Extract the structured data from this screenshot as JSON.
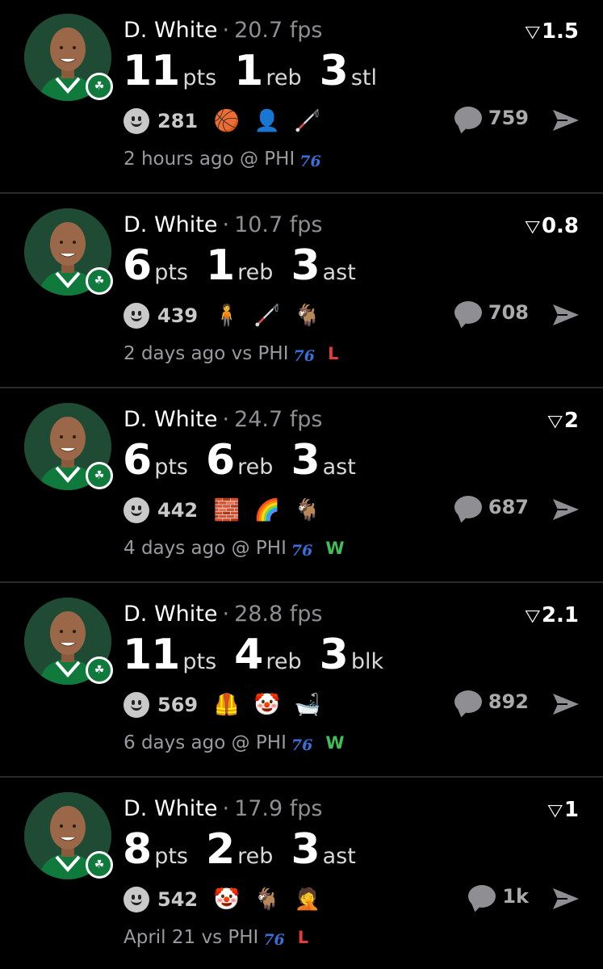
{
  "feed": {
    "posts": [
      {
        "player": "D. White",
        "fps": "20.7 fps",
        "rating": "1.5",
        "stats": [
          {
            "value": "11",
            "label": "pts"
          },
          {
            "value": "1",
            "label": "reb"
          },
          {
            "value": "3",
            "label": "stl"
          }
        ],
        "reaction_count": "281",
        "emojis": [
          "basketball-net",
          "face",
          "cane"
        ],
        "comment_count": "759",
        "time": "2 hours ago @ PHI",
        "team_logo": "76",
        "result": "",
        "result_color": ""
      },
      {
        "player": "D. White",
        "fps": "10.7 fps",
        "rating": "0.8",
        "stats": [
          {
            "value": "6",
            "label": "pts"
          },
          {
            "value": "1",
            "label": "reb"
          },
          {
            "value": "3",
            "label": "ast"
          }
        ],
        "reaction_count": "439",
        "emojis": [
          "person",
          "cane",
          "goat"
        ],
        "comment_count": "708",
        "time": "2 days ago vs PHI",
        "team_logo": "76",
        "result": "L",
        "result_color": "#e23b3b"
      },
      {
        "player": "D. White",
        "fps": "24.7 fps",
        "rating": "2",
        "stats": [
          {
            "value": "6",
            "label": "pts"
          },
          {
            "value": "6",
            "label": "reb"
          },
          {
            "value": "3",
            "label": "ast"
          }
        ],
        "reaction_count": "442",
        "emojis": [
          "brick",
          "rainbow",
          "goat"
        ],
        "comment_count": "687",
        "time": "4 days ago @ PHI",
        "team_logo": "76",
        "result": "W",
        "result_color": "#3fbf55"
      },
      {
        "player": "D. White",
        "fps": "28.8 fps",
        "rating": "2.1",
        "stats": [
          {
            "value": "11",
            "label": "pts"
          },
          {
            "value": "4",
            "label": "reb"
          },
          {
            "value": "3",
            "label": "blk"
          }
        ],
        "reaction_count": "569",
        "emojis": [
          "vest",
          "clown",
          "bathtub"
        ],
        "comment_count": "892",
        "time": "6 days ago @ PHI",
        "team_logo": "76",
        "result": "W",
        "result_color": "#3fbf55"
      },
      {
        "player": "D. White",
        "fps": "17.9 fps",
        "rating": "1",
        "stats": [
          {
            "value": "8",
            "label": "pts"
          },
          {
            "value": "2",
            "label": "reb"
          },
          {
            "value": "3",
            "label": "ast"
          }
        ],
        "reaction_count": "542",
        "emojis": [
          "clown",
          "goat",
          "face-palm"
        ],
        "comment_count": "1k",
        "time": "April 21 vs PHI",
        "team_logo": "76",
        "result": "L",
        "result_color": "#e23b3b"
      }
    ]
  },
  "colors": {
    "background": "#000000",
    "divider": "#2a2a2a",
    "muted": "#8e8e93",
    "loss": "#e23b3b",
    "win": "#3fbf55",
    "celtics_green": "#0f7a3c"
  }
}
